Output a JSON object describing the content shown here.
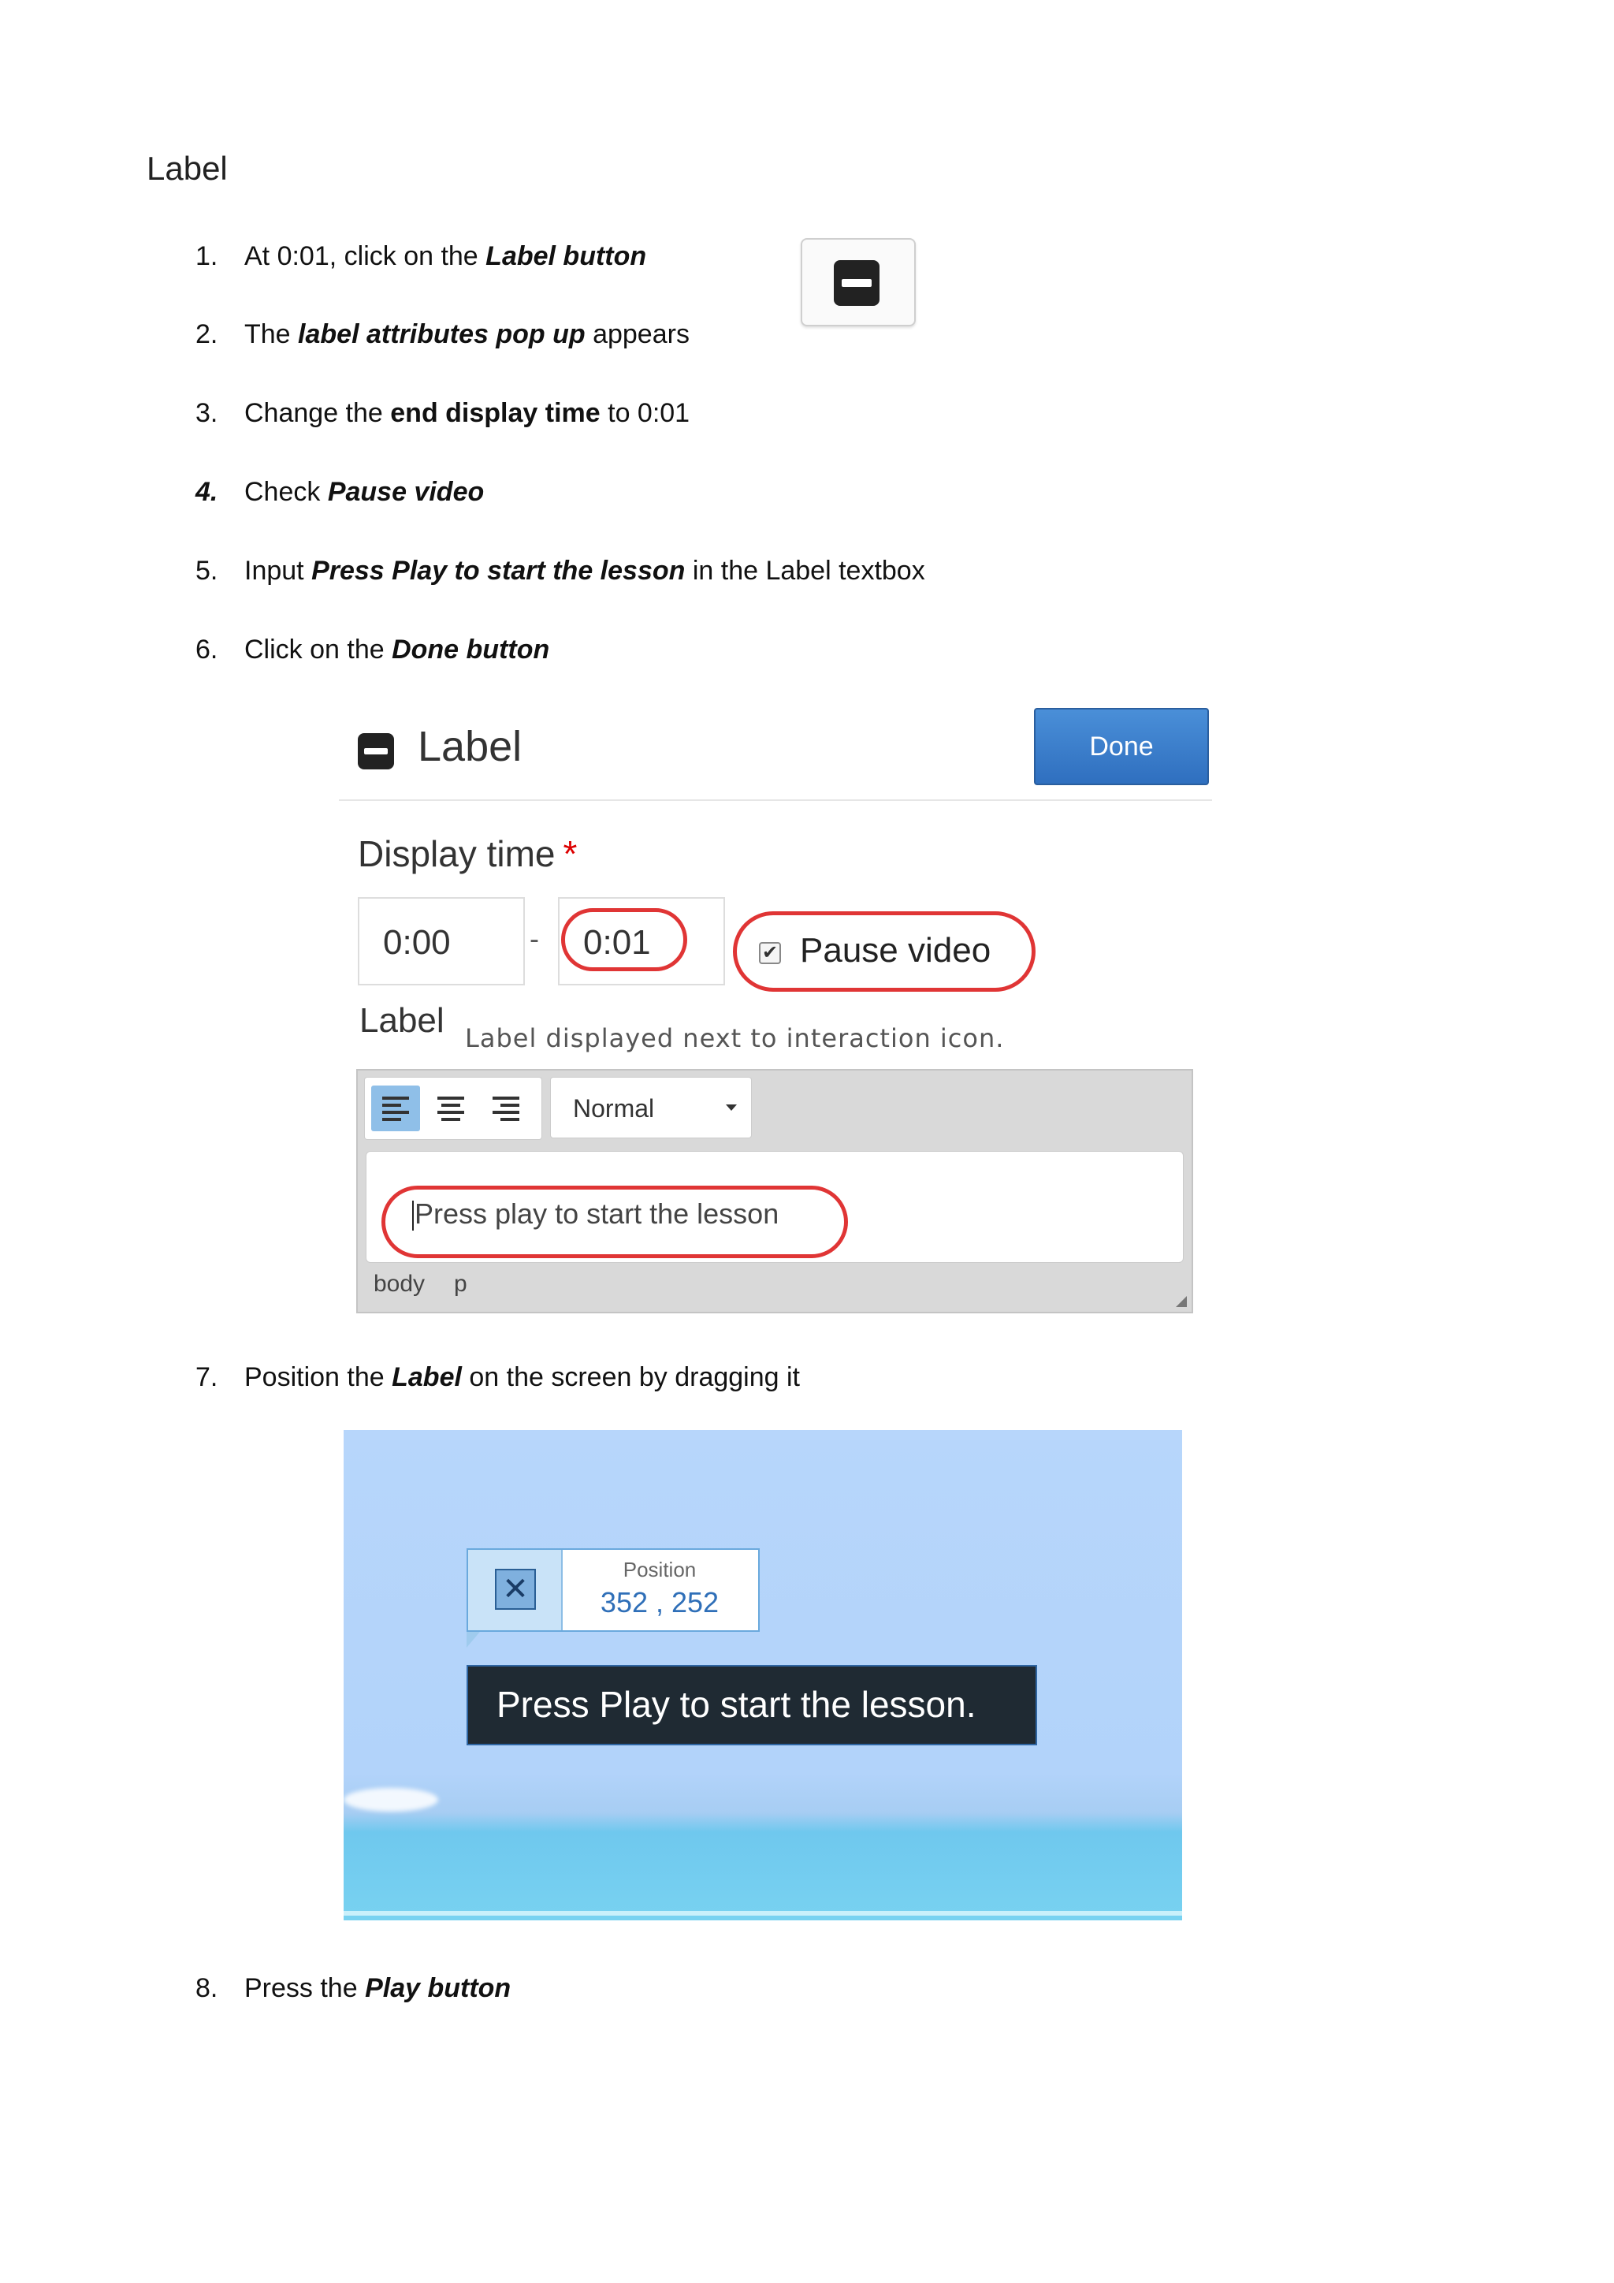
{
  "heading": "Label",
  "steps": [
    {
      "num": "1.",
      "text_a": "At 0:01, click on the ",
      "text_b": "Label button"
    },
    {
      "num": "2.",
      "text_a": "The ",
      "text_b": "label attributes pop up",
      "text_c": " appears"
    },
    {
      "num": "3.",
      "text_a": "Change the ",
      "text_b": "end display time",
      "text_c": " to 0:01"
    },
    {
      "num": "4.",
      "text_a": "Check ",
      "text_b": "Pause video"
    },
    {
      "num": "5.",
      "text_a": "Input ",
      "text_b": "Press Play to start the lesson",
      "text_c": " in the Label textbox"
    },
    {
      "num": "6.",
      "text_a": "Click on the ",
      "text_b": "Done button"
    },
    {
      "num": "7.",
      "text_a": "Position the ",
      "text_b": "Label",
      "text_c": " on the screen by dragging it"
    },
    {
      "num": "8.",
      "text_a": "Press the ",
      "text_b": "Play button"
    }
  ],
  "popup": {
    "title": "Label",
    "done_label": "Done",
    "display_time_label": "Display time",
    "required_mark": "*",
    "start_time": "0:00",
    "separator": "-",
    "end_time": "0:01",
    "pause_video_label": "Pause video",
    "pause_video_checked_mark": "✔",
    "label_title": "Label",
    "label_description": "Label displayed next to interaction icon.",
    "format_selected": "Normal",
    "editor_text": "Press play to start the lesson",
    "status_path": [
      "body",
      "p"
    ]
  },
  "preview": {
    "position_label": "Position",
    "position_value": "352 , 252",
    "label_text": "Press Play to start the lesson."
  },
  "icons": {
    "label_button": "minus-square-icon",
    "popup_title": "minus-square-icon",
    "move": "move-arrows-icon",
    "align": [
      "align-left-icon",
      "align-center-icon",
      "align-right-icon"
    ]
  },
  "colors": {
    "done_button": "#2f6fbf",
    "highlight_oval": "#e03535",
    "required": "#dd0000",
    "position_value": "#2f6fb8",
    "label_bar": "#1f2a33"
  }
}
